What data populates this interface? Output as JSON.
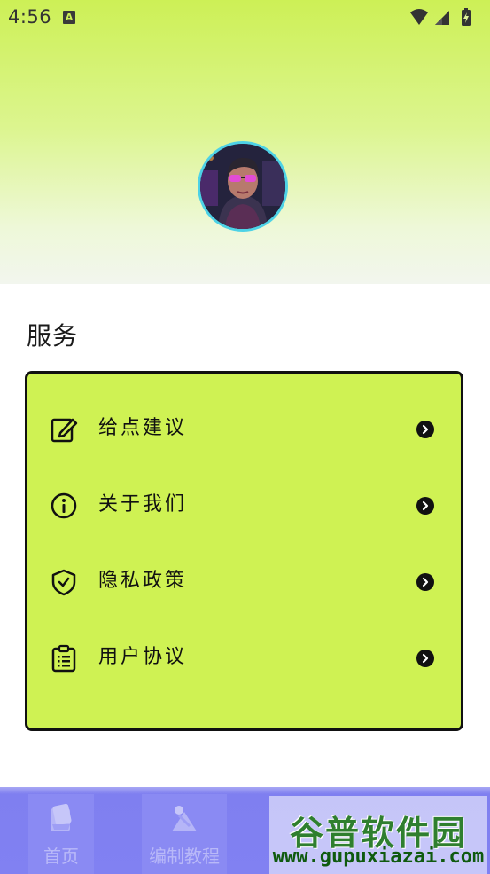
{
  "status_bar": {
    "time": "4:56",
    "notification_icon": "A",
    "icons": [
      "wifi-icon",
      "signal-icon",
      "battery-icon"
    ]
  },
  "profile": {
    "avatar": "avatar-image"
  },
  "services": {
    "title": "服务",
    "items": [
      {
        "label": "给点建议",
        "icon": "edit-icon"
      },
      {
        "label": "关于我们",
        "icon": "info-icon"
      },
      {
        "label": "隐私政策",
        "icon": "shield-icon"
      },
      {
        "label": "用户协议",
        "icon": "clipboard-icon"
      }
    ]
  },
  "bottom_nav": {
    "tabs": [
      {
        "label": "首页",
        "icon": "home-icon"
      },
      {
        "label": "编制教程",
        "icon": "tutorial-icon"
      }
    ]
  },
  "watermark": {
    "title": "谷普软件园",
    "url": "www.gupuxiazai.com"
  },
  "colors": {
    "accent": "#cff253",
    "nav": "#8181f2",
    "avatar_ring": "#4dd2e6"
  }
}
